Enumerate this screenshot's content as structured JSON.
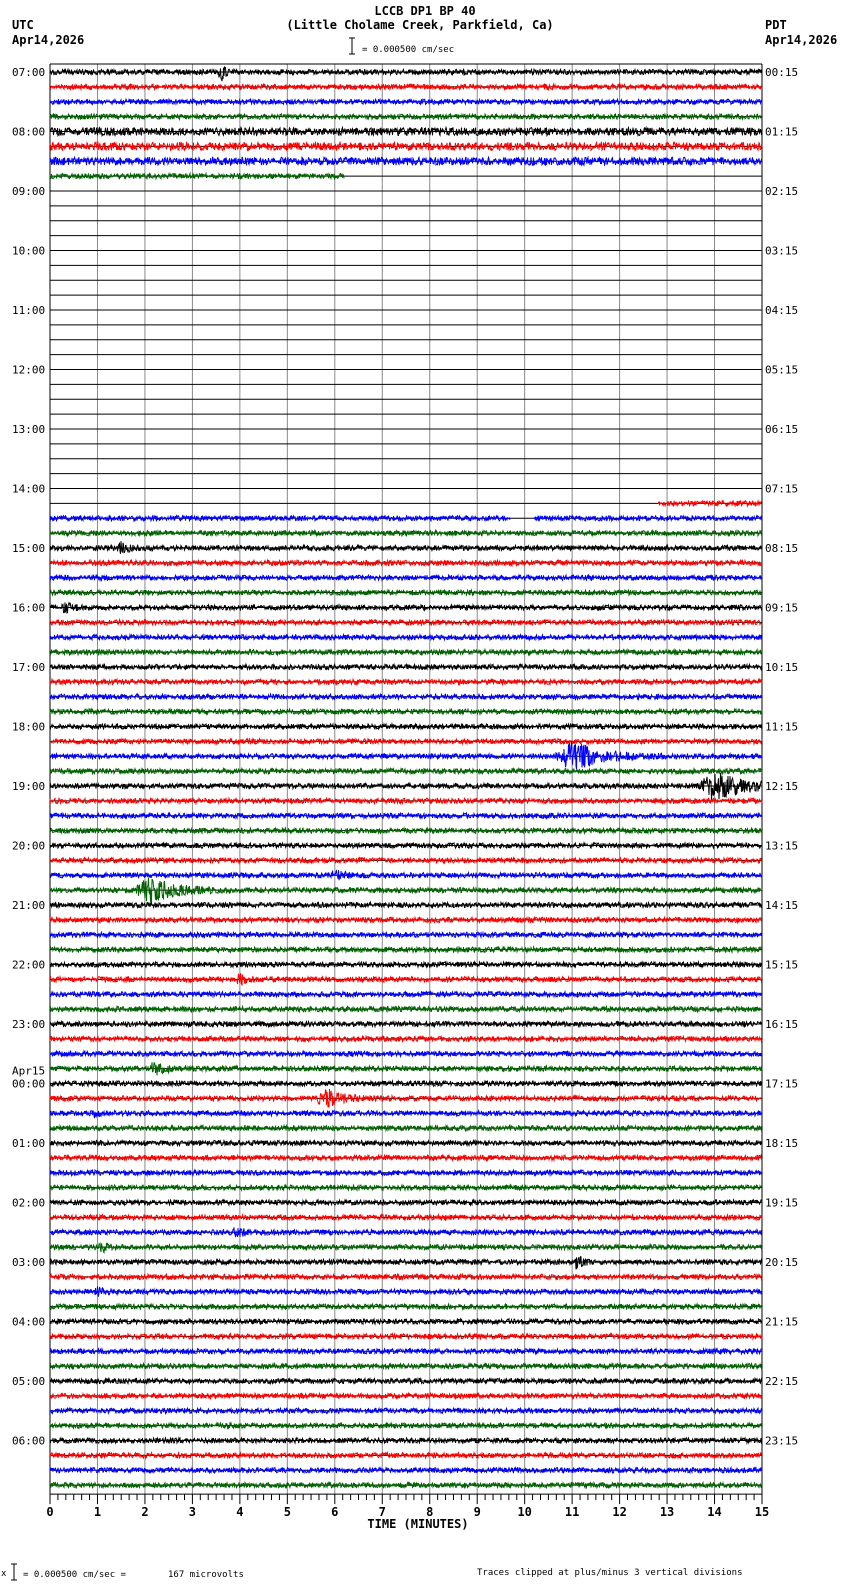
{
  "header": {
    "title": "LCCB DP1 BP 40",
    "subtitle": "(Little Cholame Creek, Parkfield, Ca)",
    "left_tz": "UTC",
    "left_date": "Apr14,2026",
    "right_tz": "PDT",
    "right_date": "Apr14,2026",
    "scale_label": "= 0.000500 cm/sec"
  },
  "footer": {
    "scale_prefix": "x",
    "scale_label": "= 0.000500 cm/sec =",
    "microvolts": "167 microvolts",
    "clip_note": "Traces clipped at plus/minus 3 vertical divisions"
  },
  "chart_data": {
    "type": "line",
    "title": "LCCB DP1 BP 40",
    "xlabel": "TIME (MINUTES)",
    "xlim": [
      0,
      15
    ],
    "x_ticks": [
      "0",
      "1",
      "2",
      "3",
      "4",
      "5",
      "6",
      "7",
      "8",
      "9",
      "10",
      "11",
      "12",
      "13",
      "14",
      "15"
    ],
    "trace_minutes": 15,
    "traces_per_hour": 4,
    "trace_count": 96,
    "trace_colors": [
      "#000000",
      "#ff0000",
      "#0000ff",
      "#006400"
    ],
    "left_labels": [
      "07:00",
      "08:00",
      "09:00",
      "10:00",
      "11:00",
      "12:00",
      "13:00",
      "14:00",
      "15:00",
      "16:00",
      "17:00",
      "18:00",
      "19:00",
      "20:00",
      "21:00",
      "22:00",
      "23:00",
      "00:00",
      "01:00",
      "02:00",
      "03:00",
      "04:00",
      "05:00",
      "06:00"
    ],
    "date_change_label": "Apr15",
    "date_change_row": 17,
    "right_labels": [
      "00:15",
      "01:15",
      "02:15",
      "03:15",
      "04:15",
      "05:15",
      "06:15",
      "07:15",
      "08:15",
      "09:15",
      "10:15",
      "11:15",
      "12:15",
      "13:15",
      "14:15",
      "15:15",
      "16:15",
      "17:15",
      "18:15",
      "19:15",
      "20:15",
      "21:15",
      "22:15",
      "23:15"
    ],
    "data_segments": [
      {
        "trace": 7,
        "segments": [
          [
            0,
            6.2
          ]
        ]
      },
      {
        "trace_range": [
          8,
          28
        ],
        "segments": []
      },
      {
        "trace": 29,
        "segments": [
          [
            12.8,
            15
          ]
        ]
      },
      {
        "trace": 30,
        "segments": [
          [
            0,
            9.7
          ],
          [
            10.2,
            15
          ]
        ]
      }
    ],
    "noisy_traces": [
      4,
      5,
      6
    ],
    "events": [
      {
        "trace": 0,
        "minute": 3.6,
        "width": 0.15,
        "amplitude": 2.0
      },
      {
        "trace": 32,
        "minute": 1.5,
        "width": 0.25,
        "amplitude": 1.0
      },
      {
        "trace": 36,
        "minute": 0.3,
        "width": 0.3,
        "amplitude": 0.8
      },
      {
        "trace": 46,
        "minute": 11.0,
        "width": 0.9,
        "amplitude": 3.0
      },
      {
        "trace": 48,
        "minute": 14.0,
        "width": 0.9,
        "amplitude": 3.0
      },
      {
        "trace": 54,
        "minute": 6.0,
        "width": 0.3,
        "amplitude": 0.8
      },
      {
        "trace": 55,
        "minute": 2.1,
        "width": 0.8,
        "amplitude": 2.5
      },
      {
        "trace": 61,
        "minute": 4.0,
        "width": 0.3,
        "amplitude": 0.8
      },
      {
        "trace": 67,
        "minute": 2.2,
        "width": 0.35,
        "amplitude": 1.2
      },
      {
        "trace": 69,
        "minute": 5.8,
        "width": 0.5,
        "amplitude": 2.0
      },
      {
        "trace": 70,
        "minute": 0.9,
        "width": 0.15,
        "amplitude": 0.8
      },
      {
        "trace": 78,
        "minute": 3.9,
        "width": 0.25,
        "amplitude": 1.0
      },
      {
        "trace": 79,
        "minute": 1.1,
        "width": 0.2,
        "amplitude": 0.8
      },
      {
        "trace": 80,
        "minute": 11.1,
        "width": 0.15,
        "amplitude": 1.8
      },
      {
        "trace": 82,
        "minute": 1.0,
        "width": 0.2,
        "amplitude": 0.7
      }
    ]
  }
}
